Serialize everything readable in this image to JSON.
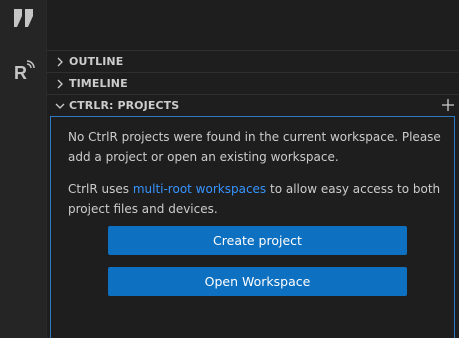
{
  "activity_bar": {
    "icons": [
      "explorer-icon",
      "ctrlr-icon"
    ]
  },
  "sections": {
    "outline": {
      "title": "OUTLINE"
    },
    "timeline": {
      "title": "TIMELINE"
    },
    "projects": {
      "title": "CTRLR: PROJECTS"
    }
  },
  "welcome": {
    "para1": "No CtrlR projects were found in the current workspace. Please add a project or open an existing workspace.",
    "para2_prefix": "CtrlR uses ",
    "para2_link": "multi-root workspaces",
    "para2_suffix": " to allow easy access to both project files and devices."
  },
  "buttons": {
    "create_project": "Create project",
    "open_workspace": "Open Workspace"
  },
  "colors": {
    "accent": "#0e70c0",
    "link": "#3794ff",
    "focus_border": "#2f78c2"
  }
}
